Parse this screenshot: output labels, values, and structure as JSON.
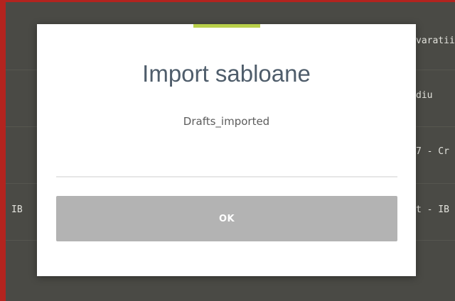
{
  "background": {
    "row_fragments": [
      "varatii",
      "diu",
      "7 - Cr",
      "IB",
      "t - IB"
    ]
  },
  "dialog": {
    "title": "Import sabloane",
    "message": "Drafts_imported",
    "ok_label": "OK"
  },
  "colors": {
    "accent": "#b9d04a",
    "button": "#b3b3b3",
    "frame": "#b3241f",
    "overlay": "#4a4a45"
  }
}
